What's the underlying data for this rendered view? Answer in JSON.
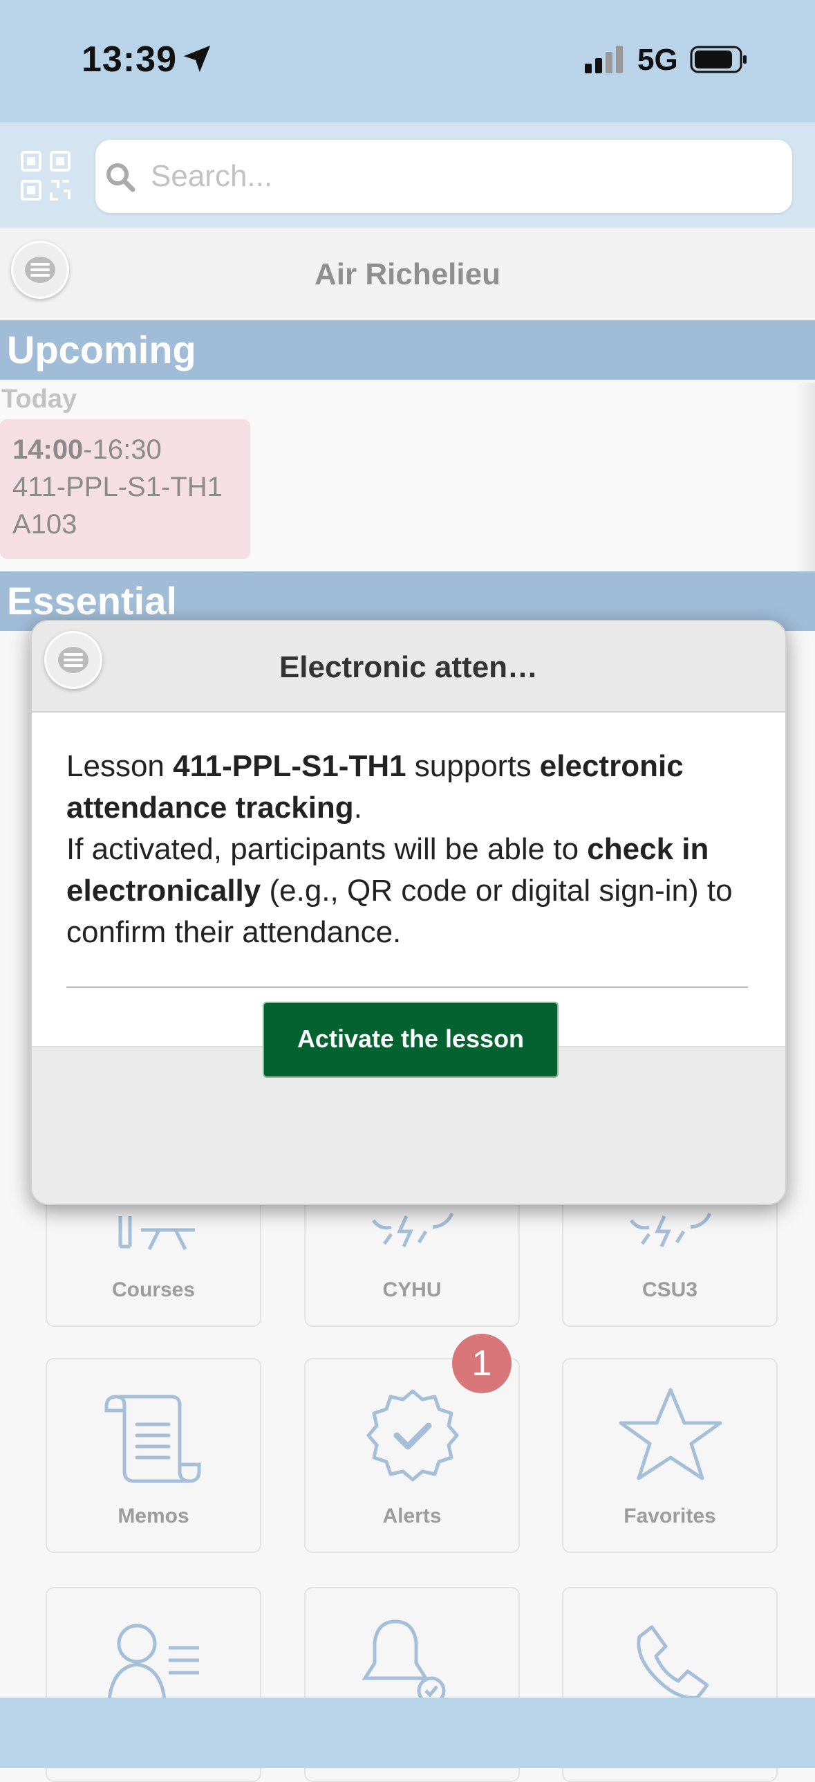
{
  "status_bar": {
    "time": "13:39",
    "network": "5G"
  },
  "search": {
    "placeholder": "Search..."
  },
  "header": {
    "title": "Air Richelieu"
  },
  "upcoming": {
    "section_title": "Upcoming",
    "day_label": "Today",
    "event": {
      "start": "14:00",
      "end": "-16:30",
      "course": "411-PPL-S1-TH1",
      "room": "A103"
    }
  },
  "essential": {
    "section_title": "Essential"
  },
  "tiles": [
    {
      "label": "Courses",
      "icon": "presentation-icon"
    },
    {
      "label": "CYHU",
      "icon": "storm-icon"
    },
    {
      "label": "CSU3",
      "icon": "storm-icon"
    },
    {
      "label": "Memos",
      "icon": "scroll-icon"
    },
    {
      "label": "Alerts",
      "icon": "badge-check-icon",
      "badge": "1"
    },
    {
      "label": "Favorites",
      "icon": "star-icon"
    },
    {
      "label": "",
      "icon": "person-list-icon"
    },
    {
      "label": "",
      "icon": "bell-person-icon"
    },
    {
      "label": "",
      "icon": "phone-icon"
    }
  ],
  "dialog": {
    "title": "Electronic atten…",
    "msg": {
      "p1": "Lesson ",
      "p2": "411-PPL-S1-TH1",
      "p3": " supports ",
      "p4": "electronic attendance tracking",
      "p5": ".",
      "p6": "If activated, participants will be able to ",
      "p7": "check in electronically",
      "p8": " (e.g., QR code or digital sign-in) to confirm their attendance."
    },
    "button_label": "Activate the lesson"
  },
  "colors": {
    "accent_blue": "#b9d3e8",
    "section_blue": "#a0bcd7",
    "button_green": "#03622f",
    "badge_red": "#d9767a",
    "event_pink": "#f6dfe4"
  }
}
